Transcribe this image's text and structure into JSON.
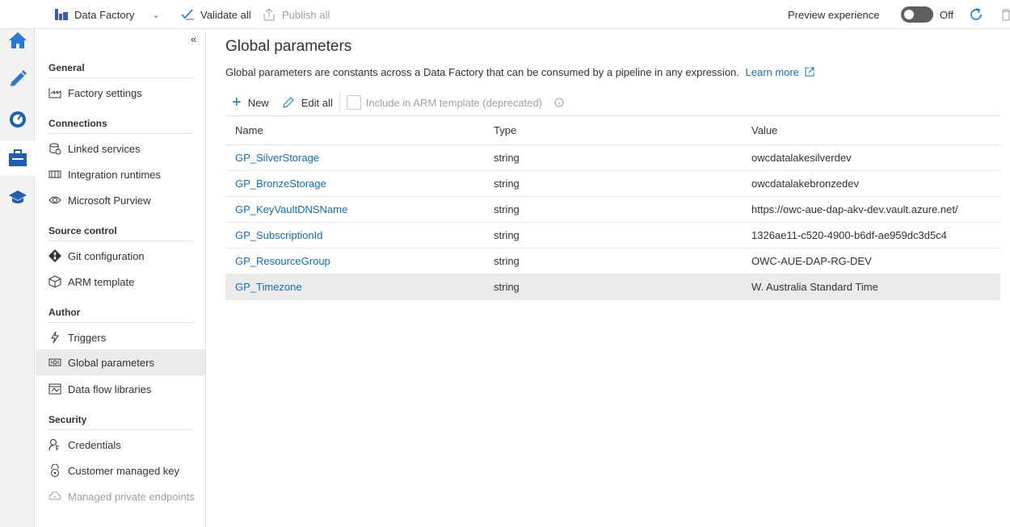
{
  "topbar": {
    "factory": "Data Factory",
    "validate": "Validate all",
    "publish": "Publish all",
    "preview_label": "Preview experience",
    "preview_state": "Off"
  },
  "nav": {
    "sections": [
      {
        "title": "General",
        "items": [
          "Factory settings"
        ]
      },
      {
        "title": "Connections",
        "items": [
          "Linked services",
          "Integration runtimes",
          "Microsoft Purview"
        ]
      },
      {
        "title": "Source control",
        "items": [
          "Git configuration",
          "ARM template"
        ]
      },
      {
        "title": "Author",
        "items": [
          "Triggers",
          "Global parameters",
          "Data flow libraries"
        ]
      },
      {
        "title": "Security",
        "items": [
          "Credentials",
          "Customer managed key",
          "Managed private endpoints"
        ]
      }
    ]
  },
  "main": {
    "title": "Global parameters",
    "description": "Global parameters are constants across a Data Factory that can be consumed by a pipeline in any expression.",
    "learn_more": "Learn more",
    "new_label": "New",
    "edit_label": "Edit all",
    "arm_label": "Include in ARM template (deprecated)",
    "columns": [
      "Name",
      "Type",
      "Value"
    ],
    "rows": [
      {
        "name": "GP_SilverStorage",
        "type": "string",
        "value": "owcdatalakesilverdev"
      },
      {
        "name": "GP_BronzeStorage",
        "type": "string",
        "value": "owcdatalakebronzedev"
      },
      {
        "name": "GP_KeyVaultDNSName",
        "type": "string",
        "value": "https://owc-aue-dap-akv-dev.vault.azure.net/"
      },
      {
        "name": "GP_SubscriptionId",
        "type": "string",
        "value": "1326ae11-c520-4900-b6df-ae959dc3d5c4"
      },
      {
        "name": "GP_ResourceGroup",
        "type": "string",
        "value": "OWC-AUE-DAP-RG-DEV"
      },
      {
        "name": "GP_Timezone",
        "type": "string",
        "value": "W. Australia Standard Time"
      }
    ]
  },
  "colors": {
    "accent": "#0078d4",
    "link": "#0f6cbd",
    "selected": "#edebe9"
  }
}
